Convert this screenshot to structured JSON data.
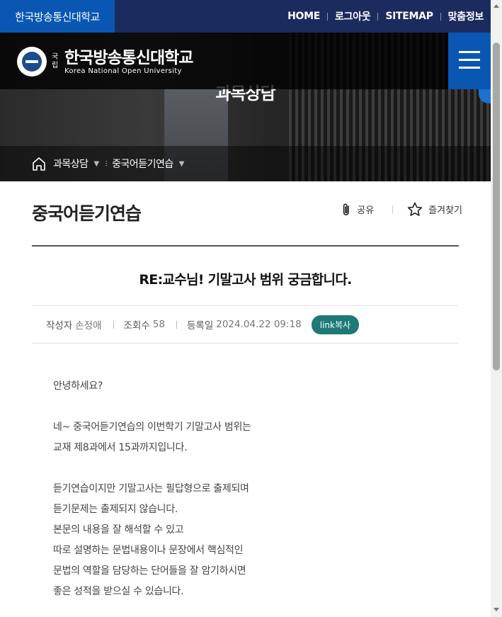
{
  "topbar": {
    "brand": "한국방송통신대학교",
    "links": [
      "HOME",
      "로그아웃",
      "SITEMAP",
      "맞춤정보"
    ]
  },
  "logo": {
    "small": "국립",
    "name_kr": "한국방송통신대학교",
    "name_en": "Korea National Open University"
  },
  "hero": {
    "section_title": "과목상담"
  },
  "breadcrumb": {
    "level1": "과목상담",
    "level2": "중국어듣기연습"
  },
  "page": {
    "title": "중국어듣기연습",
    "share_label": "공유",
    "favorite_label": "즐겨찾기"
  },
  "post": {
    "title": "RE:교수님! 기말고사 범위 궁금합니다.",
    "author_label": "작성자",
    "author": "손정애",
    "views_label": "조회수",
    "views": "58",
    "date_label": "등록일",
    "date": "2024.04.22 09:18",
    "copy_link": "link복사",
    "body": [
      "안녕하세요?",
      "",
      "네~ 중국어듣기연습의 이번학기 기말고사 범위는",
      "교재 제8과에서 15과까지입니다.",
      "",
      "듣기연습이지만 기말고사는 필답형으로 출제되며",
      "듣기문제는 출제되지 않습니다.",
      "본문의 내용을 잘 해석할 수 있고",
      "따로 설명하는 문법내용이나 문장에서 핵심적인",
      "문법의 역할을 담당하는 단어들을 잘 암기하시면",
      "좋은 성적을 받으실 수 있습니다."
    ]
  },
  "colors": {
    "top_bar": "#1b2b5e",
    "brand_blue": "#0a56b3",
    "copy_button": "#1d7a76"
  }
}
